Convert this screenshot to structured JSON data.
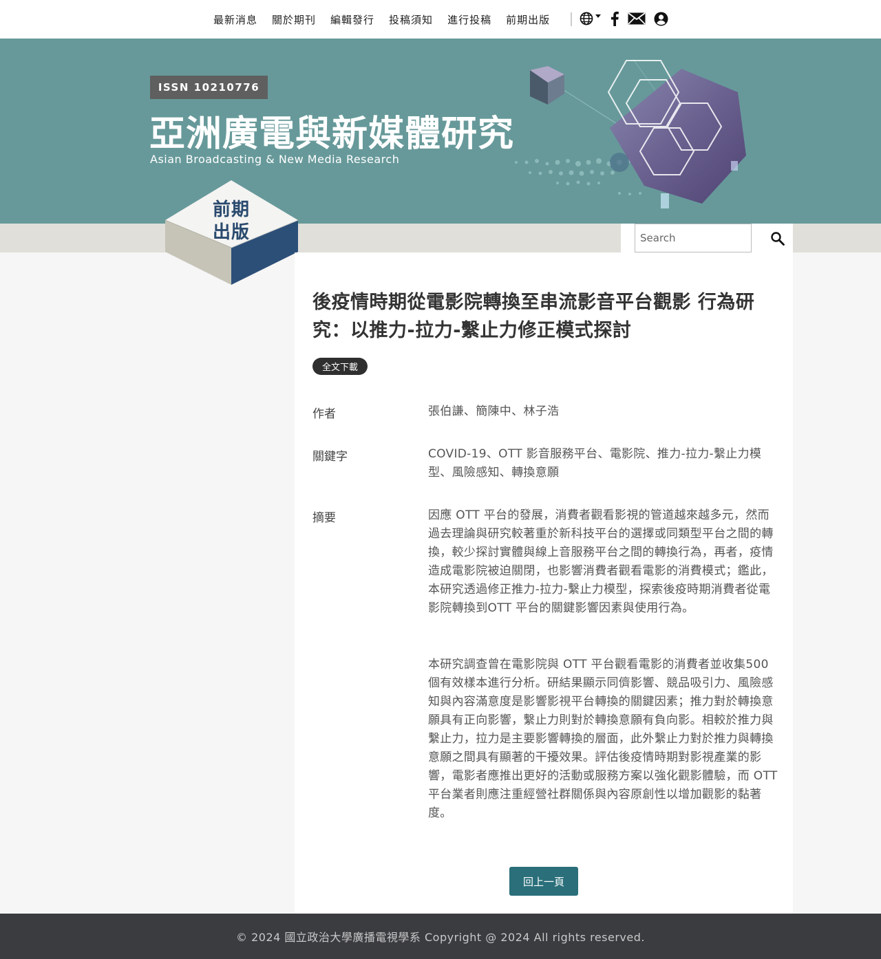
{
  "nav": {
    "items": [
      {
        "label": "最新消息"
      },
      {
        "label": "關於期刊"
      },
      {
        "label": "編輯發行"
      },
      {
        "label": "投稿須知"
      },
      {
        "label": "進行投稿"
      },
      {
        "label": "前期出版"
      }
    ],
    "icons": [
      "globe-icon",
      "caret-down-icon",
      "facebook-icon",
      "mail-icon",
      "user-icon"
    ]
  },
  "banner": {
    "issn": "ISSN 10210776",
    "title_zh": "亞洲廣電與新媒體研究",
    "title_en": "Asian Broadcasting & New Media Research",
    "bg_color": "#67999a"
  },
  "section_badge": {
    "line1": "前期",
    "line2": "出版"
  },
  "search": {
    "placeholder": "Search",
    "icon": "search-icon"
  },
  "article": {
    "title": "後疫情時期從電影院轉換至串流影音平台觀影 行為研究：以推力-拉力-繫止力修正模式探討",
    "download_label": "全文下載",
    "author_label": "作者",
    "authors": "張伯謙、簡陳中、林子浩",
    "keywords_label": "關鍵字",
    "keywords": "COVID-19、OTT 影音服務平台、電影院、推力-拉力-繫止力模型、風險感知、轉換意願",
    "abstract_label": "摘要",
    "abstract_p1": "因應 OTT 平台的發展，消費者觀看影視的管道越來越多元，然而過去理論與研究較著重於新科技平台的選擇或同類型平台之間的轉換，較少探討實體與線上音服務平台之間的轉換行為，再者，疫情造成電影院被迫關閉，也影響消費者觀看電影的消費模式；鑑此，本研究透過修正推力-拉力-繫止力模型，探索後疫時期消費者從電影院轉換到OTT 平台的關鍵影響因素與使用行為。",
    "abstract_p2": "本研究調查曾在電影院與 OTT 平台觀看電影的消費者並收集500個有效樣本進行分析。研結果顯示同儕影響、競品吸引力、風險感知與內容滿意度是影響影視平台轉換的關鍵因素；推力對於轉換意願具有正向影響，繫止力則對於轉換意願有負向影。相較於推力與繫止力，拉力是主要影響轉換的層面，此外繫止力對於推力與轉換意願之間具有顯著的干擾效果。評估後疫情時期對影視產業的影響，電影者應推出更好的活動或服務方案以強化觀影體驗，而 OTT 平台業者則應注重經營社群關係與內容原創性以增加觀影的黏著度。",
    "back_label": "回上一頁"
  },
  "footer": {
    "copyright": "© 2024 國立政治大學廣播電視學系 Copyright @ 2024 All rights reserved."
  }
}
